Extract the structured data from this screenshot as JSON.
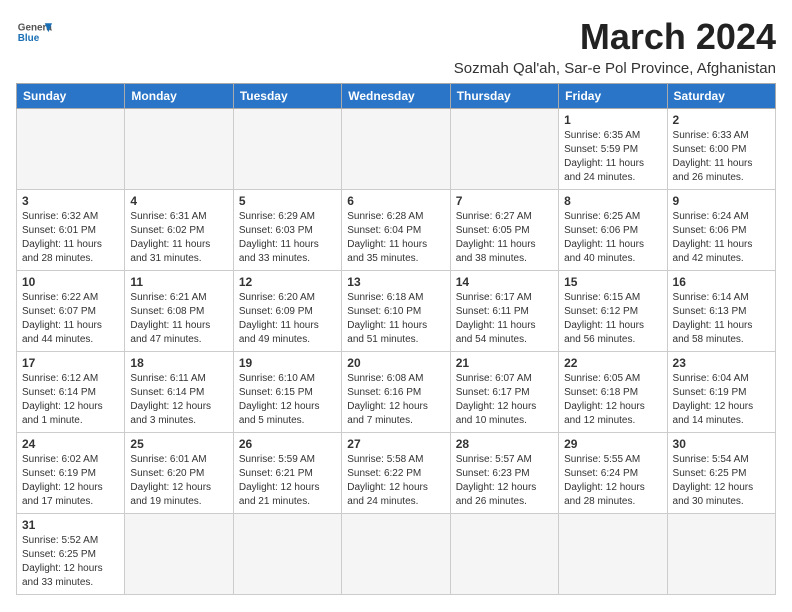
{
  "header": {
    "logo_general": "General",
    "logo_blue": "Blue",
    "month_year": "March 2024",
    "subtitle": "Sozmah Qal'ah, Sar-e Pol Province, Afghanistan"
  },
  "days_of_week": [
    "Sunday",
    "Monday",
    "Tuesday",
    "Wednesday",
    "Thursday",
    "Friday",
    "Saturday"
  ],
  "weeks": [
    [
      {
        "day": "",
        "info": ""
      },
      {
        "day": "",
        "info": ""
      },
      {
        "day": "",
        "info": ""
      },
      {
        "day": "",
        "info": ""
      },
      {
        "day": "",
        "info": ""
      },
      {
        "day": "1",
        "info": "Sunrise: 6:35 AM\nSunset: 5:59 PM\nDaylight: 11 hours and 24 minutes."
      },
      {
        "day": "2",
        "info": "Sunrise: 6:33 AM\nSunset: 6:00 PM\nDaylight: 11 hours and 26 minutes."
      }
    ],
    [
      {
        "day": "3",
        "info": "Sunrise: 6:32 AM\nSunset: 6:01 PM\nDaylight: 11 hours and 28 minutes."
      },
      {
        "day": "4",
        "info": "Sunrise: 6:31 AM\nSunset: 6:02 PM\nDaylight: 11 hours and 31 minutes."
      },
      {
        "day": "5",
        "info": "Sunrise: 6:29 AM\nSunset: 6:03 PM\nDaylight: 11 hours and 33 minutes."
      },
      {
        "day": "6",
        "info": "Sunrise: 6:28 AM\nSunset: 6:04 PM\nDaylight: 11 hours and 35 minutes."
      },
      {
        "day": "7",
        "info": "Sunrise: 6:27 AM\nSunset: 6:05 PM\nDaylight: 11 hours and 38 minutes."
      },
      {
        "day": "8",
        "info": "Sunrise: 6:25 AM\nSunset: 6:06 PM\nDaylight: 11 hours and 40 minutes."
      },
      {
        "day": "9",
        "info": "Sunrise: 6:24 AM\nSunset: 6:06 PM\nDaylight: 11 hours and 42 minutes."
      }
    ],
    [
      {
        "day": "10",
        "info": "Sunrise: 6:22 AM\nSunset: 6:07 PM\nDaylight: 11 hours and 44 minutes."
      },
      {
        "day": "11",
        "info": "Sunrise: 6:21 AM\nSunset: 6:08 PM\nDaylight: 11 hours and 47 minutes."
      },
      {
        "day": "12",
        "info": "Sunrise: 6:20 AM\nSunset: 6:09 PM\nDaylight: 11 hours and 49 minutes."
      },
      {
        "day": "13",
        "info": "Sunrise: 6:18 AM\nSunset: 6:10 PM\nDaylight: 11 hours and 51 minutes."
      },
      {
        "day": "14",
        "info": "Sunrise: 6:17 AM\nSunset: 6:11 PM\nDaylight: 11 hours and 54 minutes."
      },
      {
        "day": "15",
        "info": "Sunrise: 6:15 AM\nSunset: 6:12 PM\nDaylight: 11 hours and 56 minutes."
      },
      {
        "day": "16",
        "info": "Sunrise: 6:14 AM\nSunset: 6:13 PM\nDaylight: 11 hours and 58 minutes."
      }
    ],
    [
      {
        "day": "17",
        "info": "Sunrise: 6:12 AM\nSunset: 6:14 PM\nDaylight: 12 hours and 1 minute."
      },
      {
        "day": "18",
        "info": "Sunrise: 6:11 AM\nSunset: 6:14 PM\nDaylight: 12 hours and 3 minutes."
      },
      {
        "day": "19",
        "info": "Sunrise: 6:10 AM\nSunset: 6:15 PM\nDaylight: 12 hours and 5 minutes."
      },
      {
        "day": "20",
        "info": "Sunrise: 6:08 AM\nSunset: 6:16 PM\nDaylight: 12 hours and 7 minutes."
      },
      {
        "day": "21",
        "info": "Sunrise: 6:07 AM\nSunset: 6:17 PM\nDaylight: 12 hours and 10 minutes."
      },
      {
        "day": "22",
        "info": "Sunrise: 6:05 AM\nSunset: 6:18 PM\nDaylight: 12 hours and 12 minutes."
      },
      {
        "day": "23",
        "info": "Sunrise: 6:04 AM\nSunset: 6:19 PM\nDaylight: 12 hours and 14 minutes."
      }
    ],
    [
      {
        "day": "24",
        "info": "Sunrise: 6:02 AM\nSunset: 6:19 PM\nDaylight: 12 hours and 17 minutes."
      },
      {
        "day": "25",
        "info": "Sunrise: 6:01 AM\nSunset: 6:20 PM\nDaylight: 12 hours and 19 minutes."
      },
      {
        "day": "26",
        "info": "Sunrise: 5:59 AM\nSunset: 6:21 PM\nDaylight: 12 hours and 21 minutes."
      },
      {
        "day": "27",
        "info": "Sunrise: 5:58 AM\nSunset: 6:22 PM\nDaylight: 12 hours and 24 minutes."
      },
      {
        "day": "28",
        "info": "Sunrise: 5:57 AM\nSunset: 6:23 PM\nDaylight: 12 hours and 26 minutes."
      },
      {
        "day": "29",
        "info": "Sunrise: 5:55 AM\nSunset: 6:24 PM\nDaylight: 12 hours and 28 minutes."
      },
      {
        "day": "30",
        "info": "Sunrise: 5:54 AM\nSunset: 6:25 PM\nDaylight: 12 hours and 30 minutes."
      }
    ],
    [
      {
        "day": "31",
        "info": "Sunrise: 5:52 AM\nSunset: 6:25 PM\nDaylight: 12 hours and 33 minutes."
      },
      {
        "day": "",
        "info": ""
      },
      {
        "day": "",
        "info": ""
      },
      {
        "day": "",
        "info": ""
      },
      {
        "day": "",
        "info": ""
      },
      {
        "day": "",
        "info": ""
      },
      {
        "day": "",
        "info": ""
      }
    ]
  ]
}
